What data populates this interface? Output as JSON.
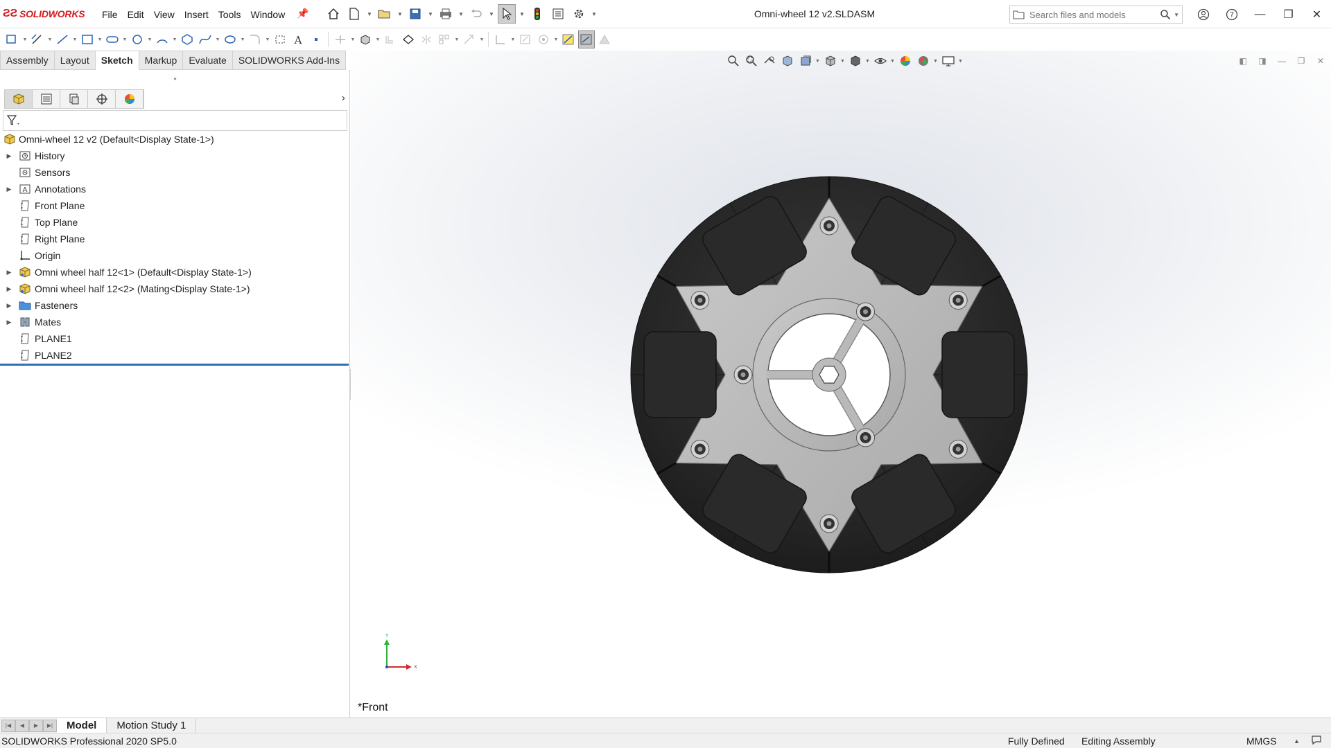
{
  "app": {
    "logo_text": "SOLIDWORKS",
    "document_title": "Omni-wheel 12 v2.SLDASM"
  },
  "menu": [
    "File",
    "Edit",
    "View",
    "Insert",
    "Tools",
    "Window"
  ],
  "search": {
    "placeholder": "Search files and models"
  },
  "tabs": [
    "Assembly",
    "Layout",
    "Sketch",
    "Markup",
    "Evaluate",
    "SOLIDWORKS Add-Ins"
  ],
  "active_tab": "Sketch",
  "tree": {
    "root": "Omni-wheel 12 v2  (Default<Display State-1>)",
    "items": [
      {
        "label": "History",
        "icon": "history-folder-icon",
        "expandable": true
      },
      {
        "label": "Sensors",
        "icon": "sensors-icon",
        "expandable": false
      },
      {
        "label": "Annotations",
        "icon": "annotations-icon",
        "expandable": true
      },
      {
        "label": "Front Plane",
        "icon": "plane-icon",
        "expandable": false
      },
      {
        "label": "Top Plane",
        "icon": "plane-icon",
        "expandable": false
      },
      {
        "label": "Right Plane",
        "icon": "plane-icon",
        "expandable": false
      },
      {
        "label": "Origin",
        "icon": "origin-icon",
        "expandable": false
      },
      {
        "label": "Omni wheel half 12<1> (Default<Display State-1>)",
        "icon": "part-icon",
        "expandable": true
      },
      {
        "label": "Omni wheel half 12<2> (Mating<Display State-1>)",
        "icon": "part-icon",
        "expandable": true
      },
      {
        "label": "Fasteners",
        "icon": "folder-icon",
        "expandable": true
      },
      {
        "label": "Mates",
        "icon": "mates-icon",
        "expandable": true
      },
      {
        "label": "PLANE1",
        "icon": "plane-icon",
        "expandable": false
      },
      {
        "label": "PLANE2",
        "icon": "plane-icon",
        "expandable": false
      }
    ]
  },
  "viewport": {
    "view_name": "*Front",
    "triad_y": "Y",
    "triad_x": "X"
  },
  "bottom_tabs": [
    "Model",
    "Motion Study 1"
  ],
  "status": {
    "product": "SOLIDWORKS Professional 2020 SP5.0",
    "definition": "Fully Defined",
    "mode": "Editing Assembly",
    "units": "MMGS"
  },
  "colors": {
    "accent_red": "#d71920",
    "rollback_blue": "#2f6fb3",
    "roller_black": "#2b2b2b",
    "hub_gray": "#b9b9b9"
  }
}
